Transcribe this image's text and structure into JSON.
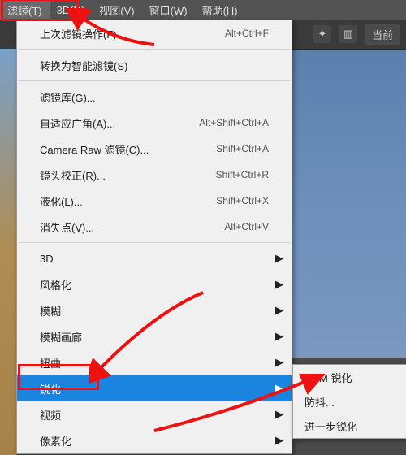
{
  "menubar": {
    "items": [
      "滤镜(T)",
      "3D(D)",
      "视图(V)",
      "窗口(W)",
      "帮助(H)"
    ],
    "activeIndex": 0
  },
  "toolbar": {
    "tab": "当前"
  },
  "menu": {
    "groups": [
      [
        {
          "label": "上次滤镜操作(F)",
          "shortcut": "Alt+Ctrl+F"
        }
      ],
      [
        {
          "label": "转换为智能滤镜(S)"
        }
      ],
      [
        {
          "label": "滤镜库(G)..."
        },
        {
          "label": "自适应广角(A)...",
          "shortcut": "Alt+Shift+Ctrl+A"
        },
        {
          "label": "Camera Raw 滤镜(C)...",
          "shortcut": "Shift+Ctrl+A"
        },
        {
          "label": "镜头校正(R)...",
          "shortcut": "Shift+Ctrl+R"
        },
        {
          "label": "液化(L)...",
          "shortcut": "Shift+Ctrl+X"
        },
        {
          "label": "消失点(V)...",
          "shortcut": "Alt+Ctrl+V"
        }
      ],
      [
        {
          "label": "3D",
          "submenu": true
        },
        {
          "label": "风格化",
          "submenu": true
        },
        {
          "label": "模糊",
          "submenu": true
        },
        {
          "label": "模糊画廊",
          "submenu": true
        },
        {
          "label": "扭曲",
          "submenu": true
        },
        {
          "label": "锐化",
          "submenu": true,
          "hi": true
        },
        {
          "label": "视频",
          "submenu": true
        },
        {
          "label": "像素化",
          "submenu": true
        }
      ]
    ]
  },
  "submenu": [
    "USM 锐化",
    "防抖...",
    "进一步锐化"
  ]
}
